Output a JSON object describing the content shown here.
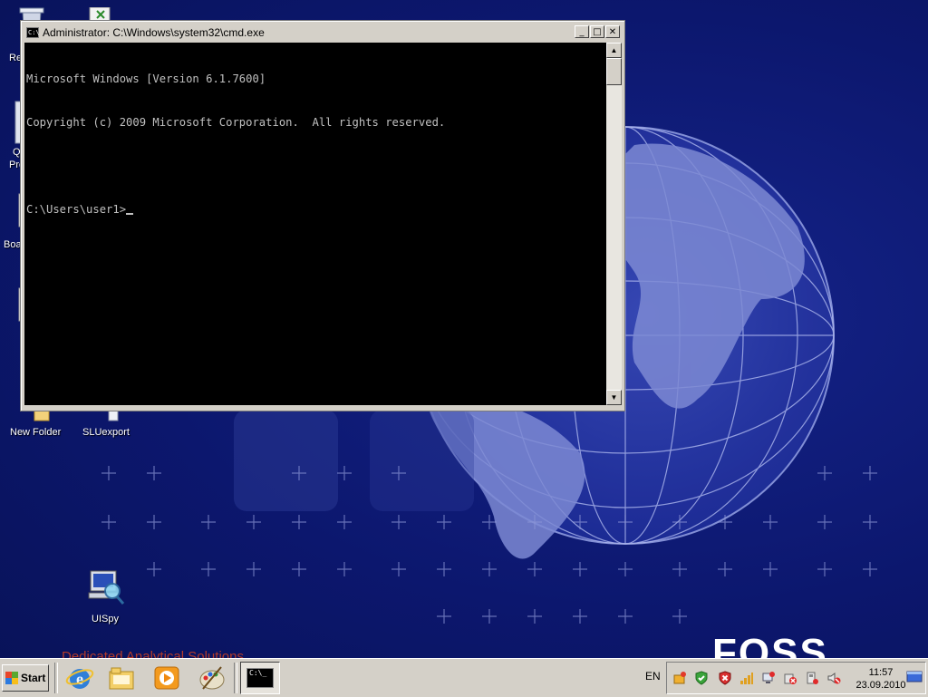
{
  "desktop": {
    "icons": [
      {
        "name": "recycle-bin",
        "label": "Re"
      },
      {
        "name": "excel-doc",
        "label": ""
      },
      {
        "name": "quick-program",
        "label_line1": "Q",
        "label_line2": "Pro"
      },
      {
        "name": "board",
        "label": "Boa"
      },
      {
        "name": "new-folder",
        "label": "New Folder"
      },
      {
        "name": "sluexport",
        "label": "SLUexport"
      },
      {
        "name": "uispy",
        "label": "UISpy"
      }
    ],
    "wallpaper": {
      "brand": "FOSS",
      "tagline": "Dedicated Analytical Solutions"
    }
  },
  "cmd_window": {
    "title": "Administrator: C:\\Windows\\system32\\cmd.exe",
    "title_icon_text": "C:\\",
    "buttons": {
      "minimize": "_",
      "maximize": "□",
      "close": "✕"
    },
    "console_lines": [
      "Microsoft Windows [Version 6.1.7600]",
      "Copyright (c) 2009 Microsoft Corporation.  All rights reserved.",
      "",
      "C:\\Users\\user1>"
    ]
  },
  "taskbar": {
    "start_label": "Start",
    "quick_launch": [
      "internet-explorer",
      "windows-explorer",
      "media-player",
      "paint"
    ],
    "active_task_icon_text": "C:\\_",
    "language": "EN",
    "clock": {
      "time": "11:57",
      "date": "23.09.2010"
    }
  },
  "colors": {
    "desktop_bg": "#0c176e",
    "console_bg": "#000000",
    "console_text": "#c0c0c0",
    "chrome": "#d4d0c8"
  }
}
